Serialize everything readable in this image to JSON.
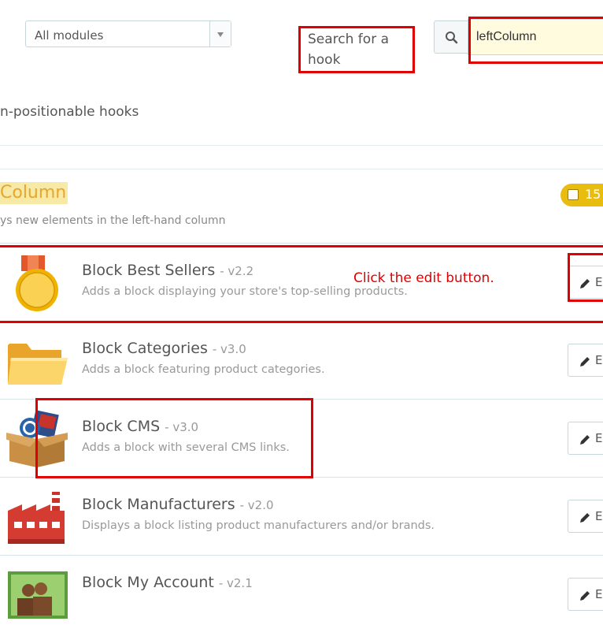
{
  "filters": {
    "module_select_value": "All modules",
    "search_label": "Search for a hook",
    "search_value": "leftColumn",
    "non_positionable_label": "n-positionable hooks"
  },
  "hook": {
    "title": "Column",
    "description": "ys new elements in the left-hand column",
    "count": "15"
  },
  "modules": [
    {
      "name": "Block Best Sellers",
      "version": "- v2.2",
      "description": "Adds a block displaying your store's top-selling products.",
      "edit_label": "E"
    },
    {
      "name": "Block Categories",
      "version": "- v3.0",
      "description": "Adds a block featuring product categories.",
      "edit_label": "E"
    },
    {
      "name": "Block CMS",
      "version": "- v3.0",
      "description": "Adds a block with several CMS links.",
      "edit_label": "E"
    },
    {
      "name": "Block Manufacturers",
      "version": "- v2.0",
      "description": "Displays a block listing product manufacturers and/or brands.",
      "edit_label": "E"
    },
    {
      "name": "Block My Account",
      "version": "- v2.1",
      "description": "",
      "edit_label": "E"
    }
  ],
  "annotation": {
    "text": "Click the edit button.",
    "color": "#e00000"
  },
  "colors": {
    "hook_title": "#e8a62f",
    "hook_highlight": "#f7e9a6",
    "badge": "#e9bd0f"
  }
}
